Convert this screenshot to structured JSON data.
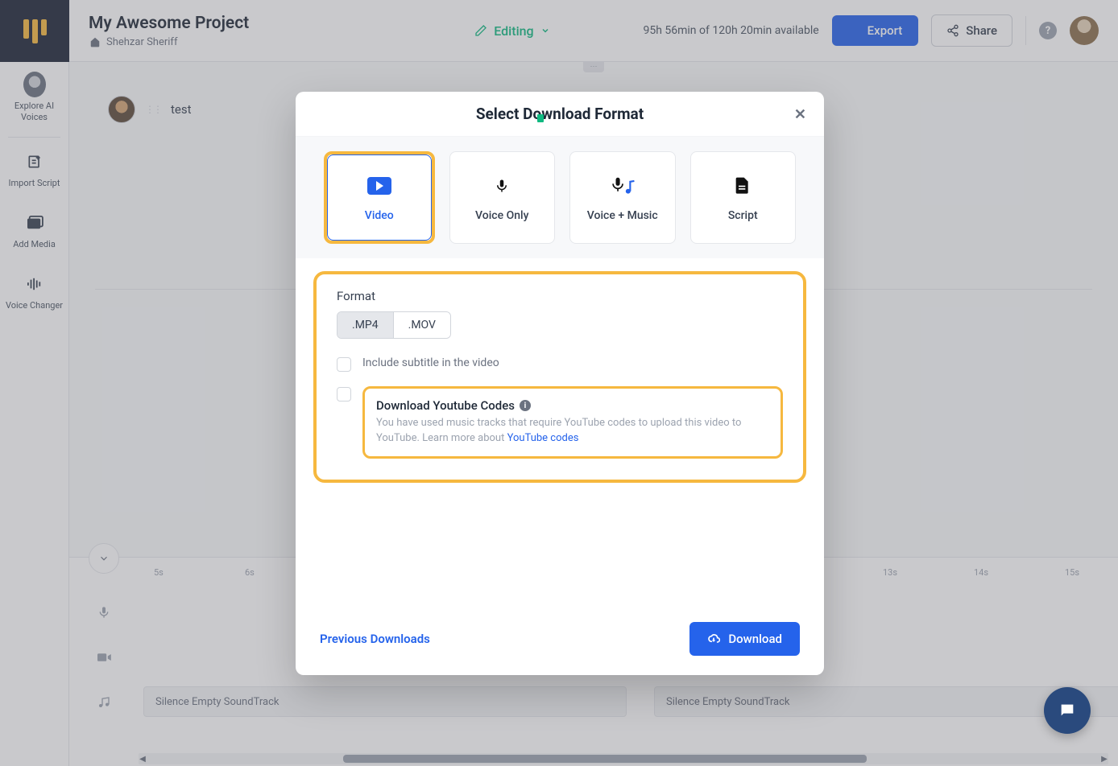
{
  "header": {
    "project_title": "My Awesome Project",
    "author": "Shehzar Sheriff",
    "status": "Editing",
    "time_available": "95h 56min of 120h 20min available",
    "export": "Export",
    "share": "Share"
  },
  "sidebar": {
    "items": [
      {
        "label": "Explore AI Voices"
      },
      {
        "label": "Import Script"
      },
      {
        "label": "Add Media"
      },
      {
        "label": "Voice Changer"
      }
    ]
  },
  "canvas": {
    "block_label": "test"
  },
  "timeline": {
    "marks": [
      "5s",
      "6s",
      "13s",
      "14s",
      "15s"
    ],
    "silence1": "Silence Empty SoundTrack",
    "silence2": "Silence Empty SoundTrack"
  },
  "modal": {
    "title": "Select Download Format",
    "tabs": {
      "video": "Video",
      "voice_only": "Voice Only",
      "voice_music": "Voice + Music",
      "script": "Script"
    },
    "format_label": "Format",
    "mp4": ".MP4",
    "mov": ".MOV",
    "subtitle_label": "Include subtitle in the video",
    "youtube": {
      "title": "Download Youtube Codes",
      "desc": "You have used music tracks that require YouTube codes to upload this video to YouTube. Learn more about ",
      "link": "YouTube codes"
    },
    "previous": "Previous Downloads",
    "download": "Download"
  }
}
